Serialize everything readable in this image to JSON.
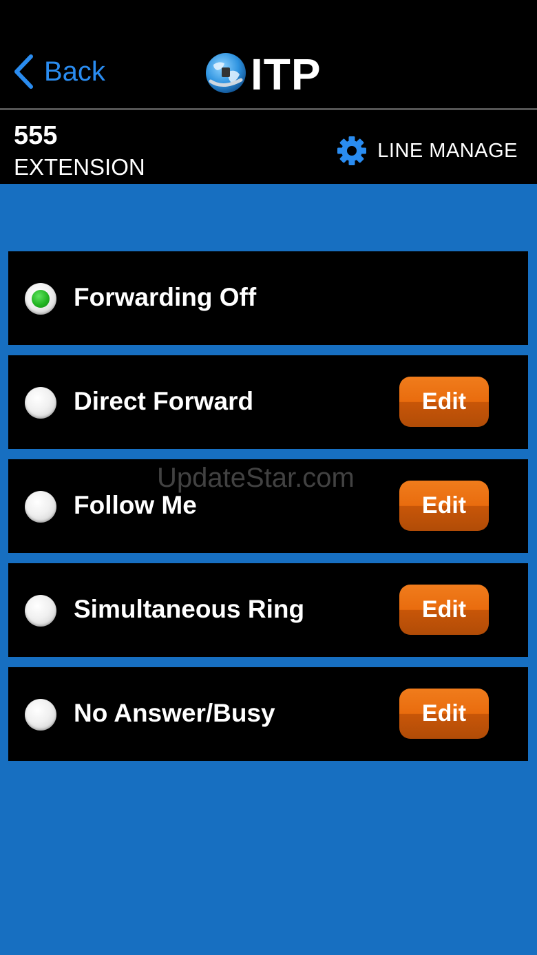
{
  "nav": {
    "back_label": "Back",
    "logo_text": "ITP",
    "accent_color": "#2a8cf0"
  },
  "extension": {
    "number": "555",
    "label": "EXTENSION"
  },
  "line_manage": {
    "label": "LINE MANAGE",
    "icon": "gear-icon"
  },
  "options": [
    {
      "label": "Forwarding Off",
      "selected": true,
      "has_edit": false
    },
    {
      "label": "Direct Forward",
      "selected": false,
      "has_edit": true,
      "edit_label": "Edit"
    },
    {
      "label": "Follow Me",
      "selected": false,
      "has_edit": true,
      "edit_label": "Edit"
    },
    {
      "label": "Simultaneous Ring",
      "selected": false,
      "has_edit": true,
      "edit_label": "Edit"
    },
    {
      "label": "No Answer/Busy",
      "selected": false,
      "has_edit": true,
      "edit_label": "Edit"
    }
  ],
  "watermark": "UpdateStar.com",
  "colors": {
    "background": "#176fc1",
    "edit_button": "#e96c0e",
    "selected_radio": "#22b522"
  }
}
